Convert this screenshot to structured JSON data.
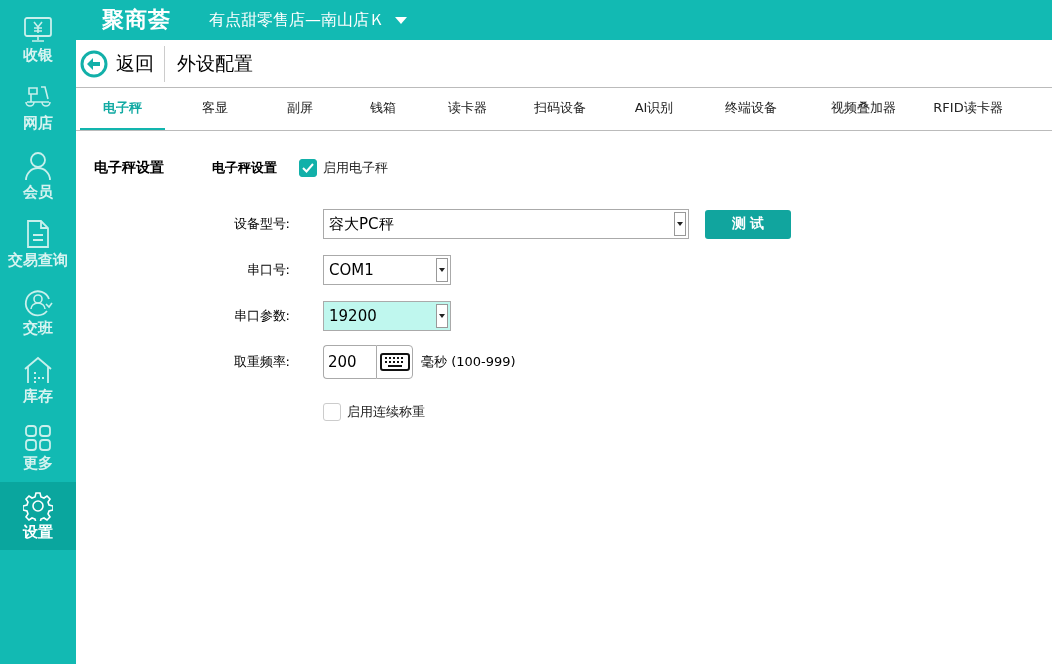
{
  "sidebar": {
    "items": [
      {
        "label": "收银",
        "selected": false
      },
      {
        "label": "网店",
        "selected": false
      },
      {
        "label": "会员",
        "selected": false
      },
      {
        "label": "交易查询",
        "selected": false
      },
      {
        "label": "交班",
        "selected": false
      },
      {
        "label": "库存",
        "selected": false
      },
      {
        "label": "更多",
        "selected": false
      },
      {
        "label": "设置",
        "selected": true
      }
    ]
  },
  "header": {
    "logo": "聚商荟",
    "store": "有点甜零售店—南山店Ｋ"
  },
  "toolbar": {
    "back": "返回",
    "title": "外设配置"
  },
  "tabs": [
    {
      "label": "电子秤",
      "selected": true
    },
    {
      "label": "客显",
      "selected": false
    },
    {
      "label": "副屏",
      "selected": false
    },
    {
      "label": "钱箱",
      "selected": false
    },
    {
      "label": "读卡器",
      "selected": false
    },
    {
      "label": "扫码设备",
      "selected": false
    },
    {
      "label": "AI识别",
      "selected": false
    },
    {
      "label": "终端设备",
      "selected": false
    },
    {
      "label": "视频叠加器",
      "selected": false
    },
    {
      "label": "RFID读卡器",
      "selected": false
    }
  ],
  "section": {
    "title": "电子秤设置",
    "subtitle": "电子秤设置",
    "enable": {
      "label": "启用电子秤",
      "checked": true
    },
    "fields": [
      {
        "kind": "select",
        "label": "设备型号:",
        "value": "容大PC秤",
        "focused": false,
        "button": "测 试"
      },
      {
        "kind": "select",
        "label": "串口号:",
        "value": "COM1",
        "focused": false
      },
      {
        "kind": "select",
        "label": "串口参数:",
        "value": "19200",
        "focused": true
      },
      {
        "kind": "keypad",
        "label": "取重频率:",
        "value": "200",
        "unit": "毫秒 (100-999)"
      }
    ],
    "continuous": {
      "label": "启用连续称重",
      "checked": false
    }
  }
}
